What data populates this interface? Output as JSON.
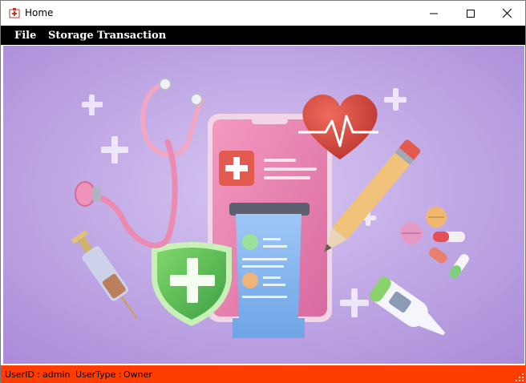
{
  "window": {
    "title": "Home",
    "controls": {
      "minimize": "minimize-icon",
      "maximize": "maximize-icon",
      "close": "close-icon"
    }
  },
  "menu": {
    "items": [
      {
        "label": "File"
      },
      {
        "label": "Storage"
      },
      {
        "label": "Transaction"
      }
    ]
  },
  "status": {
    "user_id_label": "UserID :",
    "user_id_value": "admin",
    "user_type_label": "UserType :",
    "user_type_value": "Owner",
    "bar_color": "#ff3d00"
  },
  "hero": {
    "background_color": "#b9a3e3"
  }
}
